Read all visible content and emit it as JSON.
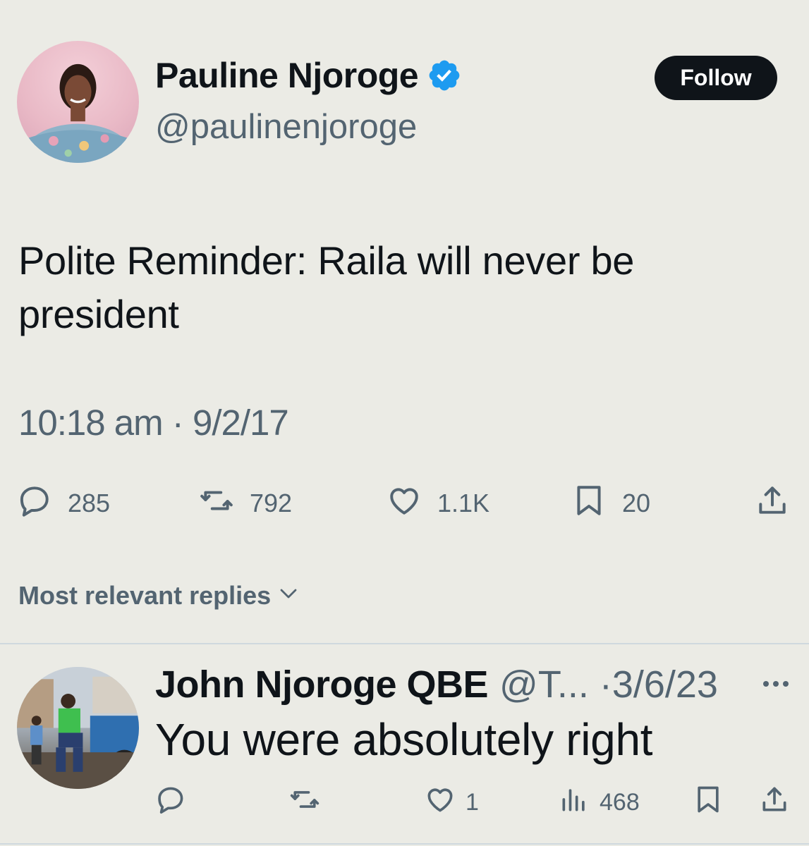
{
  "tweet": {
    "author": {
      "name": "Pauline Njoroge",
      "handle": "@paulinenjoroge",
      "verified": true,
      "verified_color": "#1d9bf0"
    },
    "follow_label": "Follow",
    "text": "Polite Reminder: Raila will never be president",
    "timestamp": "10:18 am · 9/2/17",
    "stats": {
      "replies": "285",
      "retweets": "792",
      "likes": "1.1K",
      "bookmarks": "20"
    },
    "icons": [
      "reply-icon",
      "retweet-icon",
      "like-icon",
      "bookmark-icon",
      "share-icon"
    ]
  },
  "replies_sort": {
    "label": "Most relevant replies"
  },
  "reply": {
    "name": "John Njoroge QBE",
    "handle_date": "@T... ·3/6/23",
    "text": "You were absolutely right",
    "stats": {
      "likes": "1",
      "views": "468"
    },
    "icons": [
      "reply-icon",
      "retweet-icon",
      "like-icon",
      "views-icon",
      "bookmark-icon",
      "share-icon",
      "more-icon"
    ]
  },
  "colors": {
    "background": "#ebebe5",
    "text": "#0f1419",
    "secondary": "#536471",
    "button": "#0f1419"
  }
}
